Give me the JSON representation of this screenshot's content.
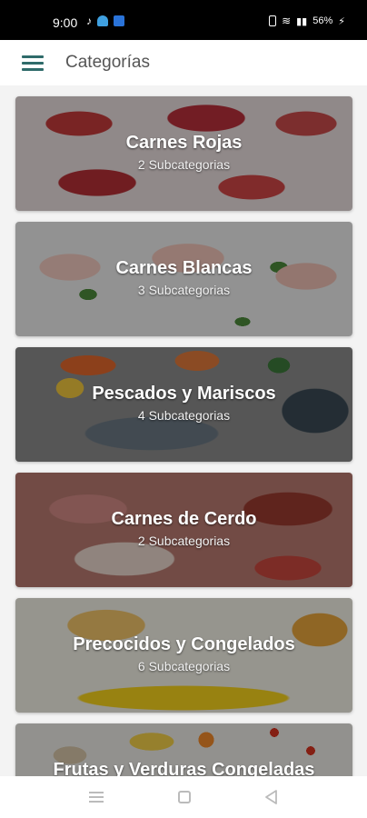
{
  "status_bar": {
    "time": "9:00",
    "battery": "56%"
  },
  "app_bar": {
    "title": "Categorías"
  },
  "categories": [
    {
      "title": "Carnes Rojas",
      "subtitle": "2 Subcategorias"
    },
    {
      "title": "Carnes Blancas",
      "subtitle": "3 Subcategorias"
    },
    {
      "title": "Pescados y Mariscos",
      "subtitle": "4 Subcategorias"
    },
    {
      "title": "Carnes de Cerdo",
      "subtitle": "2 Subcategorias"
    },
    {
      "title": "Precocidos y Congelados",
      "subtitle": "6 Subcategorias"
    },
    {
      "title": "Frutas y Verduras Congeladas",
      "subtitle": ""
    }
  ]
}
